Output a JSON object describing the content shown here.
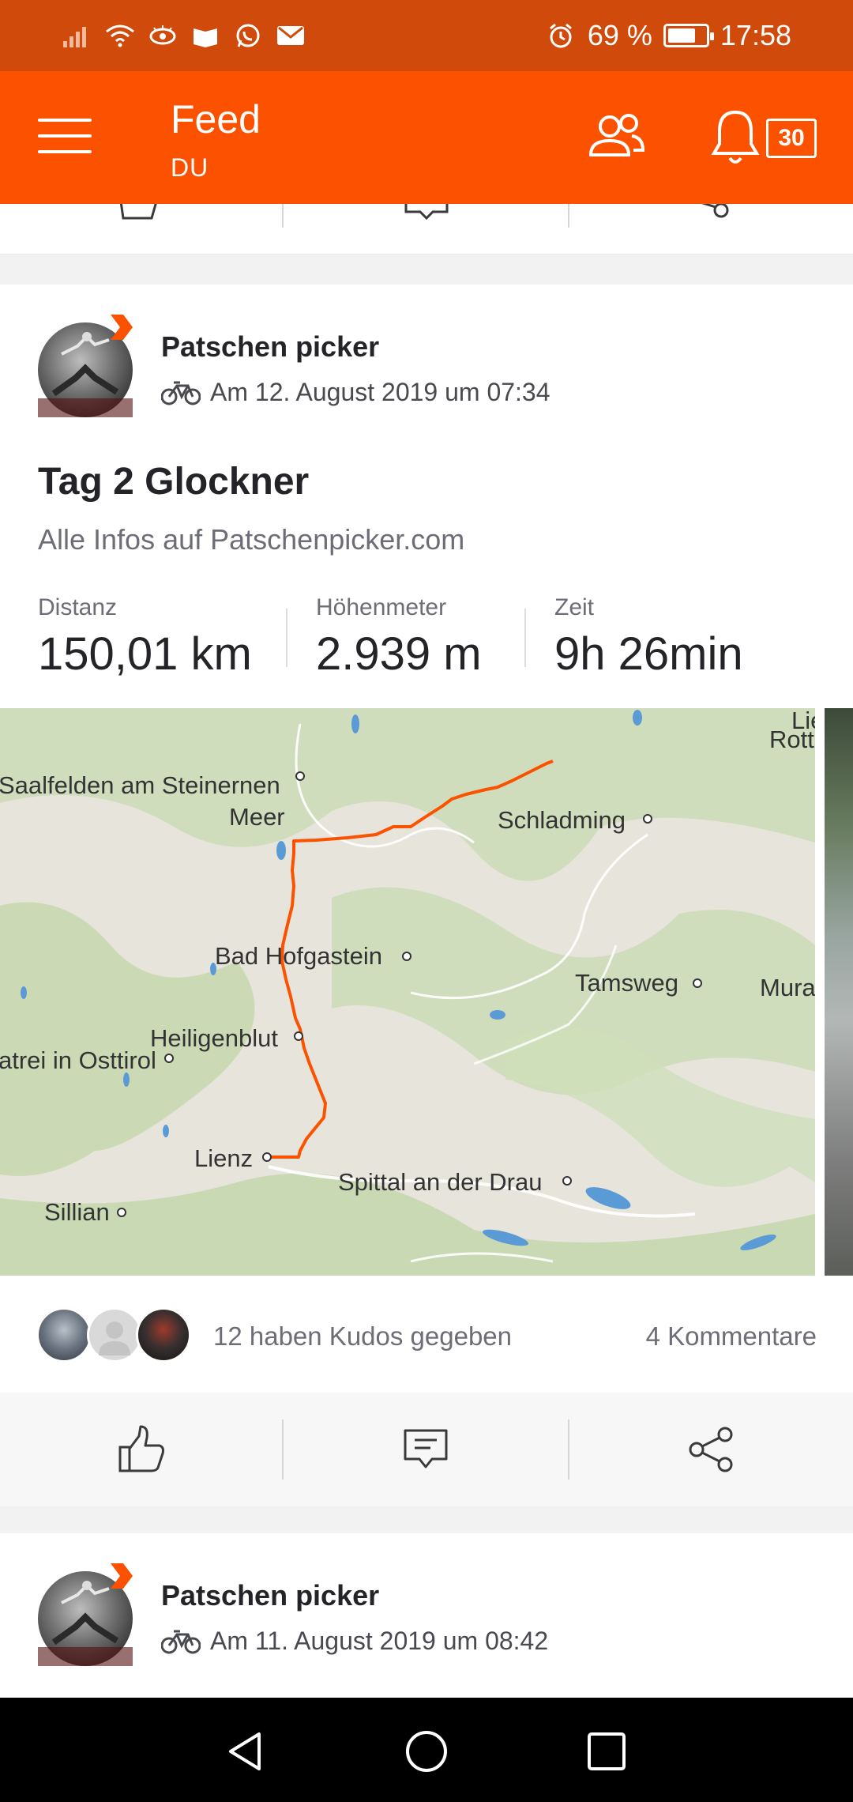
{
  "status_bar": {
    "battery": "69 %",
    "battery_level": 0.69,
    "time": "17:58"
  },
  "app_bar": {
    "title": "Feed",
    "subtitle": "DU",
    "notification_count": "30"
  },
  "feed": [
    {
      "athlete": "Patschen picker",
      "activity_icon": "bicycle-icon",
      "date": "Am 12. August 2019 um 07:34",
      "title": "Tag 2 Glockner",
      "description": "Alle Infos auf Patschenpicker.com",
      "stats": [
        {
          "label": "Distanz",
          "value": "150,01 km"
        },
        {
          "label": "Höhenmeter",
          "value": "2.939 m"
        },
        {
          "label": "Zeit",
          "value": "9h 26min"
        }
      ],
      "map_places": [
        "Saalfelden am Steinernen",
        "Meer",
        "Schladming",
        "Bad Hofgastein",
        "Tamsweg",
        "Mura",
        "Heiligenblut",
        "atrei in Osttirol",
        "Lienz",
        "Spittal an der Drau",
        "Sillian",
        "Lie",
        "Rott"
      ],
      "kudos": "12 haben Kudos gegeben",
      "comments": "4 Kommentare"
    },
    {
      "athlete": "Patschen picker",
      "activity_icon": "bicycle-icon",
      "date": "Am 11. August 2019 um 08:42"
    }
  ],
  "colors": {
    "brand": "#fc5200",
    "status_bar": "#d04a0b",
    "route": "#fc5200"
  }
}
